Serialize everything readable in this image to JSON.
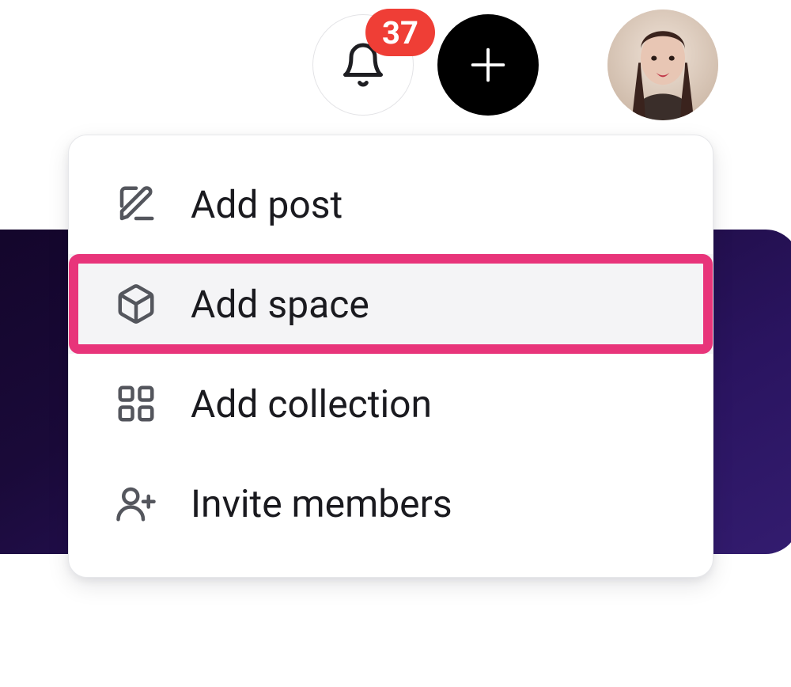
{
  "header": {
    "notification_count": "37"
  },
  "menu": {
    "items": [
      {
        "label": "Add post"
      },
      {
        "label": "Add space"
      },
      {
        "label": "Add collection"
      },
      {
        "label": "Invite members"
      }
    ]
  },
  "colors": {
    "badge": "#ef3e36",
    "highlight": "#e8347a"
  }
}
